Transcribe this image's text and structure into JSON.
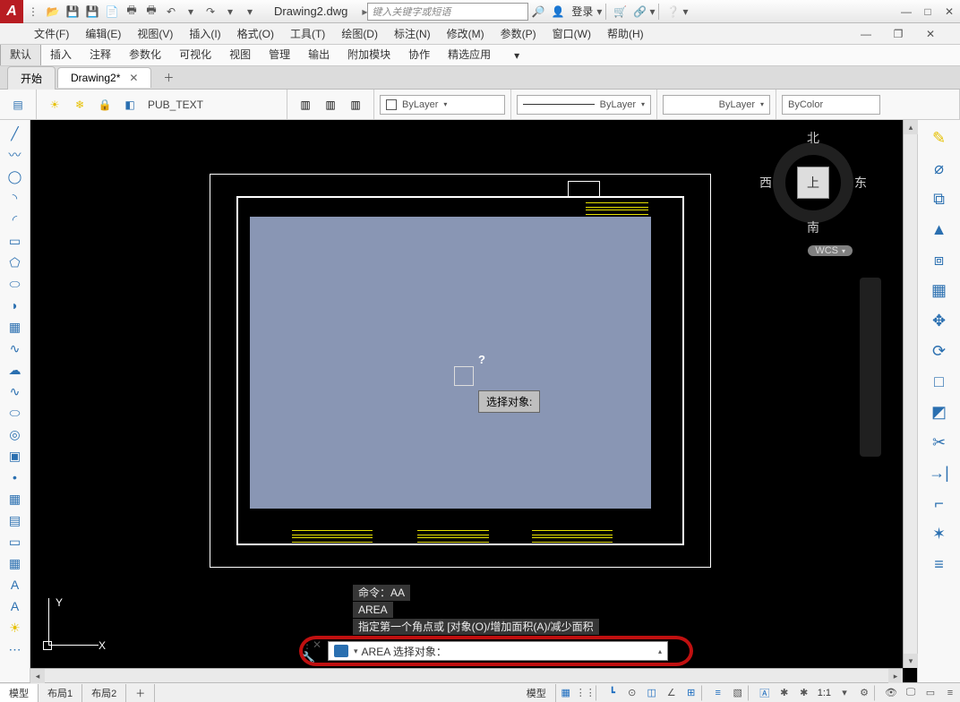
{
  "titlebar": {
    "qat_icons": [
      "folder-open-icon",
      "save-icon",
      "save-as-icon",
      "plot-icon",
      "undo-icon",
      "redo-icon"
    ],
    "doc_name": "Drawing2.dwg",
    "search_placeholder": "键入关键字或短语",
    "login_label": "登录"
  },
  "menubar": {
    "items": [
      "文件(F)",
      "编辑(E)",
      "视图(V)",
      "插入(I)",
      "格式(O)",
      "工具(T)",
      "绘图(D)",
      "标注(N)",
      "修改(M)",
      "参数(P)",
      "窗口(W)",
      "帮助(H)"
    ]
  },
  "ribbontabs": {
    "items": [
      "默认",
      "插入",
      "注释",
      "参数化",
      "可视化",
      "视图",
      "管理",
      "输出",
      "附加模块",
      "协作",
      "精选应用"
    ],
    "active_index": 0
  },
  "doctabs": {
    "items": [
      {
        "label": "开始",
        "active": false,
        "closable": false
      },
      {
        "label": "Drawing2*",
        "active": true,
        "closable": true
      }
    ]
  },
  "toolbar2": {
    "layer_name": "PUB_TEXT",
    "bylayer1": "ByLayer",
    "bylayer2": "ByLayer",
    "bylayer3": "ByLayer",
    "bycolor": "ByColor"
  },
  "canvas": {
    "tooltip": "选择对象:",
    "cursor_help": "?",
    "axis_x": "X",
    "axis_y": "Y",
    "viewcube": {
      "top": "北",
      "bottom": "南",
      "left": "西",
      "right": "东",
      "face": "上"
    },
    "wcs": "WCS"
  },
  "command": {
    "history": [
      "命令：AA",
      "AREA",
      "指定第一个角点或 [对象(O)/增加面积(A)/减少面积"
    ],
    "prompt": "AREA 选择对象："
  },
  "statusbar": {
    "layout_tabs": [
      "模型",
      "布局1",
      "布局2"
    ],
    "active_layout": 0,
    "model_label": "模型",
    "scale": "1:1"
  }
}
